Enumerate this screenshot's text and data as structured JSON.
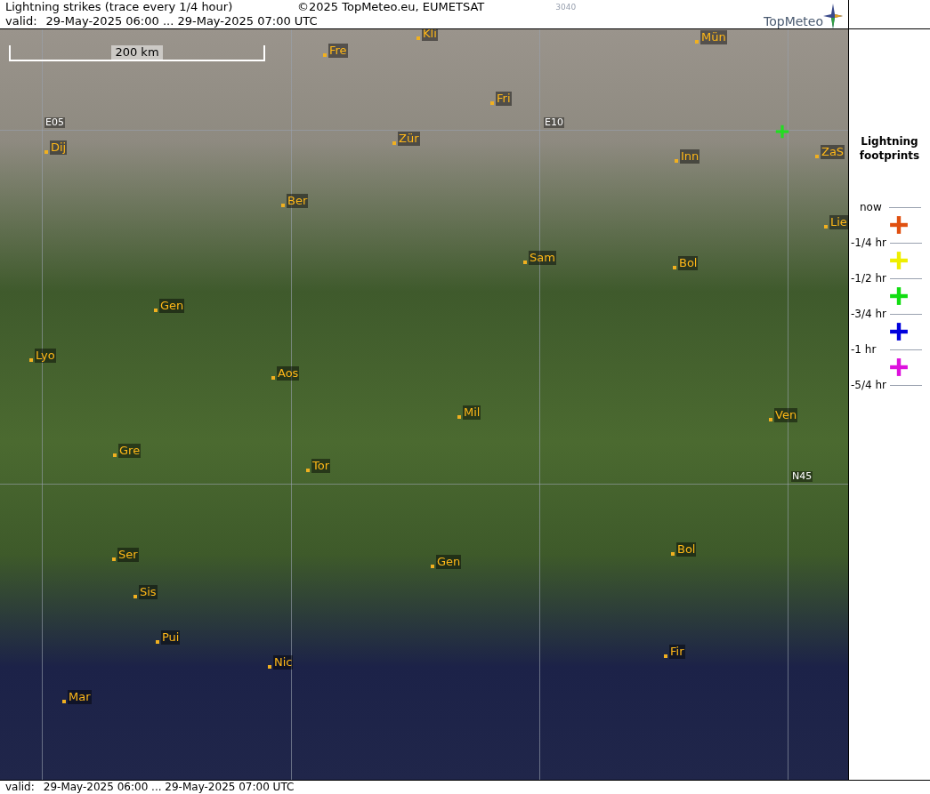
{
  "header": {
    "title": "Lightning strikes (trace every 1/4 hour)",
    "copyright": "©2025 TopMeteo.eu, EUMETSAT",
    "code": "3040",
    "valid_label": "valid:",
    "valid_range": "29-May-2025 06:00 ... 29-May-2025 07:00 UTC",
    "logo": "TopMeteo"
  },
  "map": {
    "scale": "200 km",
    "grid_labels": [
      "E05",
      "E10",
      "N45"
    ],
    "cities": [
      "Kli",
      "Fre",
      "Mün",
      "Fri",
      "Dij",
      "Zür",
      "Inn",
      "ZaS",
      "Ber",
      "Lie",
      "Sam",
      "Bol",
      "Gen",
      "Lyo",
      "Aos",
      "Mil",
      "Ven",
      "Gre",
      "Tor",
      "Gen",
      "Bol",
      "Ser",
      "Sis",
      "Pui",
      "Nic",
      "Fir",
      "Mar"
    ],
    "strikes": [
      {
        "color": "#22dd22"
      }
    ]
  },
  "legend": {
    "title": "Lightning footprints",
    "top_label": "now",
    "entries": [
      {
        "label": "-1/4 hr",
        "color": "#e05010"
      },
      {
        "label": "-1/2 hr",
        "color": "#eeee00"
      },
      {
        "label": "-3/4 hr",
        "color": "#11dd11"
      },
      {
        "label": "-1 hr",
        "color": "#0000dd"
      },
      {
        "label": "-5/4 hr",
        "color": "#dd11dd"
      }
    ]
  },
  "footer": {
    "valid_label": "valid:",
    "valid_range": "29-May-2025 06:00 ... 29-May-2025 07:00 UTC"
  }
}
